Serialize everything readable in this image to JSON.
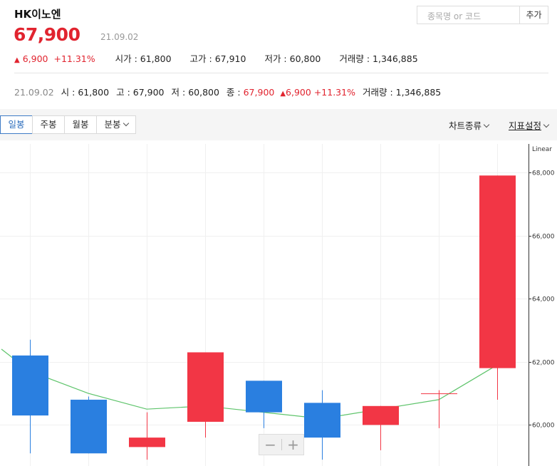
{
  "stock": {
    "name": "HK이노엔",
    "price": "67,900",
    "date": "21.09.02",
    "change_arrow": "▲",
    "change": "6,900",
    "change_pct": "+11.31%"
  },
  "summary": [
    {
      "label": "시가",
      "value": "61,800"
    },
    {
      "label": "고가",
      "value": "67,910"
    },
    {
      "label": "저가",
      "value": "60,800"
    },
    {
      "label": "거래량",
      "value": "1,346,885"
    }
  ],
  "search": {
    "placeholder": "종목명 or 코드",
    "add_label": "추가"
  },
  "detail": {
    "date": "21.09.02",
    "open_label": "시",
    "open": "61,800",
    "high_label": "고",
    "high": "67,900",
    "low_label": "저",
    "low": "60,800",
    "close_label": "종",
    "close": "67,900",
    "change_arrow": "▲",
    "change": "6,900",
    "change_pct": "+11.31%",
    "volume_label": "거래량",
    "volume": "1,346,885"
  },
  "toolbar": {
    "tabs": [
      "일봉",
      "주봉",
      "월봉",
      "분봉"
    ],
    "active_tab": "일봉",
    "chart_type_label": "차트종류",
    "indicator_label": "지표설정"
  },
  "zoom": {
    "minus": "−",
    "plus": "+"
  },
  "colors": {
    "up": "#f23645",
    "down": "#2a7fe0",
    "ma": "#5ec46b",
    "accent": "#e1242f"
  },
  "chart_data": {
    "type": "candlestick",
    "scale_label": "Linear",
    "y_ticks": [
      "68,000",
      "66,000",
      "64,000",
      "62,000",
      "60,000"
    ],
    "y_tick_values": [
      68000,
      66000,
      64000,
      62000,
      60000
    ],
    "ylim": [
      58700,
      68900
    ],
    "candles": [
      {
        "open": 62200,
        "close": 60300,
        "high": 62700,
        "low": 59100
      },
      {
        "open": 60800,
        "close": 59100,
        "high": 60900,
        "low": 59100
      },
      {
        "open": 59300,
        "close": 59600,
        "high": 60400,
        "low": 58900
      },
      {
        "open": 60100,
        "close": 62300,
        "high": 62300,
        "low": 59600
      },
      {
        "open": 61400,
        "close": 60400,
        "high": 61400,
        "low": 59900
      },
      {
        "open": 60700,
        "close": 59600,
        "high": 61100,
        "low": 58900
      },
      {
        "open": 60000,
        "close": 60600,
        "high": 60600,
        "low": 59200
      },
      {
        "open": 61000,
        "close": 61000,
        "high": 61100,
        "low": 59900
      },
      {
        "open": 61800,
        "close": 67900,
        "high": 67900,
        "low": 60800
      }
    ],
    "moving_average": [
      62400,
      61700,
      61000,
      60500,
      60600,
      60400,
      60200,
      60500,
      60800,
      61900
    ]
  }
}
